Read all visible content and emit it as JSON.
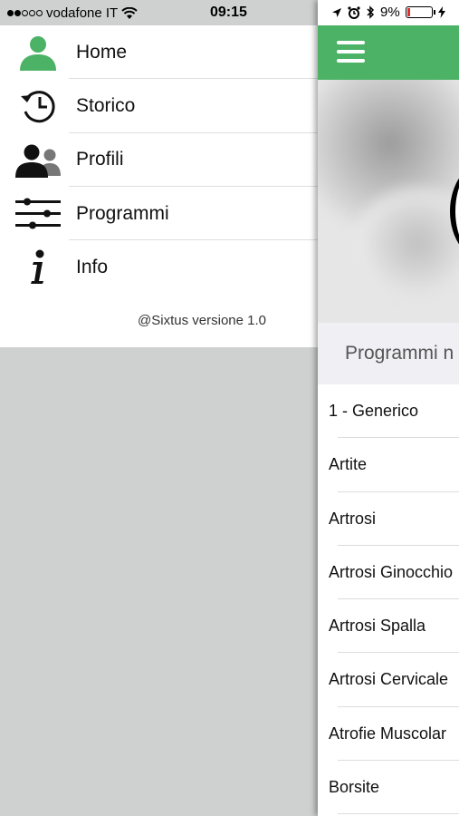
{
  "status_bar": {
    "carrier": "vodafone IT",
    "time": "09:15",
    "battery": "9%"
  },
  "menu": {
    "items": [
      {
        "label": "Home",
        "icon": "person-icon"
      },
      {
        "label": "Storico",
        "icon": "history-icon"
      },
      {
        "label": "Profili",
        "icon": "profiles-icon"
      },
      {
        "label": "Programmi",
        "icon": "sliders-icon"
      },
      {
        "label": "Info",
        "icon": "info-icon"
      }
    ],
    "version": "@Sixtus versione 1.0"
  },
  "colors": {
    "accent": "#4cb266",
    "battery_low": "#e0302b"
  },
  "main": {
    "section_header": "Programmi n",
    "programs": [
      "1 - Generico",
      "Artite",
      "Artrosi",
      "Artrosi Ginocchio",
      "Artrosi Spalla",
      "Artrosi Cervicale",
      "Atrofie Muscolar",
      "Borsite"
    ]
  }
}
